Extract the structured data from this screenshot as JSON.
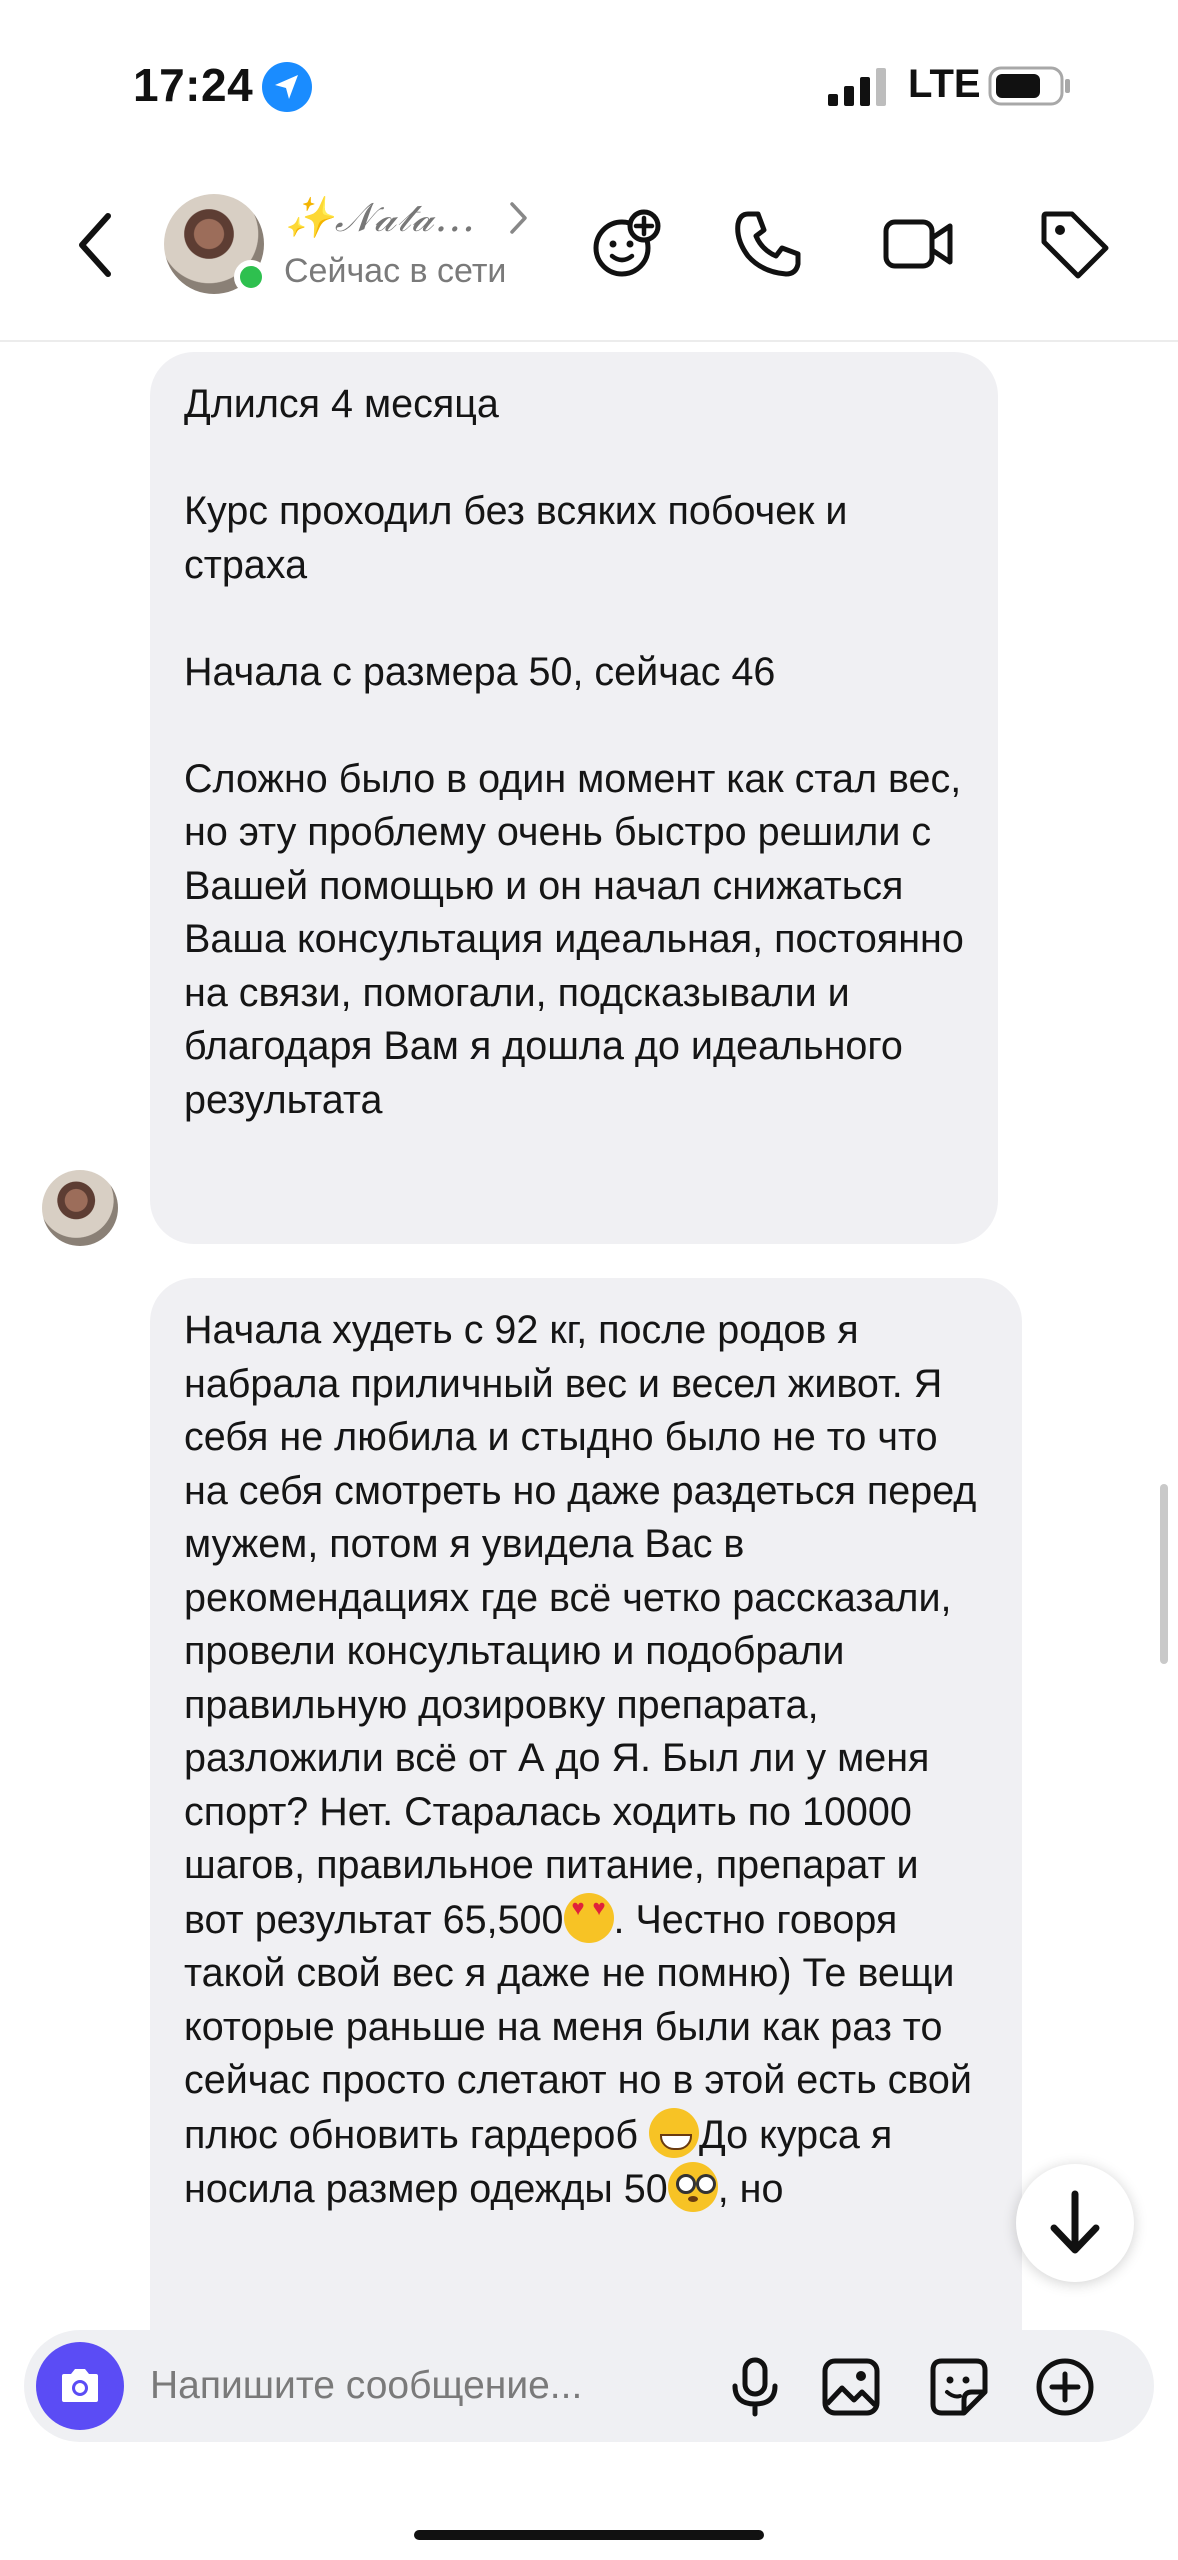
{
  "status_bar": {
    "time": "17:24",
    "network": "LTE",
    "icons": [
      "location-arrow-icon",
      "signal-icon",
      "battery-icon"
    ]
  },
  "header": {
    "contact_name": "✨𝒩𝒶𝓉𝒶...",
    "contact_status": "Сейчас в сети",
    "icons": [
      "back-icon",
      "add-sticker-icon",
      "phone-icon",
      "video-icon",
      "tag-icon"
    ]
  },
  "messages": [
    {
      "text": "Длился 4 месяца\n\nКурс проходил без всяких побочек и страха\n\nНачала с размера 50, сейчас 46\n\nСложно было в один момент как стал вес, но эту проблему очень быстро решили с Вашей помощью и он начал снижаться\nВаша консультация идеальная, постоянно на связи, помогали, подсказывали и благодаря Вам я дошла до идеального результата"
    },
    {
      "text_part1": "Начала худеть с 92 кг, после родов я набрала приличный вес и весел живот. Я себя не любила и стыдно было не то что на себя смотреть но даже раздеться перед мужем, потом я увидела Вас в рекомендациях где всё четко рассказали, провели консультацию и подобрали правильную дозировку препарата, разложили всё от А до Я. Был ли у меня спорт? Нет. Старалась ходить по 10000 шагов, правильное питание, препарат и вот результат 65,500",
      "emoji1": "heart-eyes-emoji",
      "text_part2": ". Честно говоря такой свой вес я даже не помню) Те вещи которые раньше на меня были как раз то сейчас просто слетают но в этой есть свой плюс обновить гардероб ",
      "emoji2": "grin-emoji",
      "text_part3": "До курса я носила размер одежды 50",
      "emoji3": "flushed-emoji",
      "text_part4": ", но"
    }
  ],
  "composer": {
    "placeholder": "Напишите сообщение...",
    "icons": [
      "camera-icon",
      "microphone-icon",
      "gallery-icon",
      "sticker-icon",
      "plus-icon"
    ]
  },
  "colors": {
    "accent": "#5b4cf5",
    "online": "#2ec04f",
    "bubble": "#f0f0f3",
    "location": "#1a8cff"
  }
}
